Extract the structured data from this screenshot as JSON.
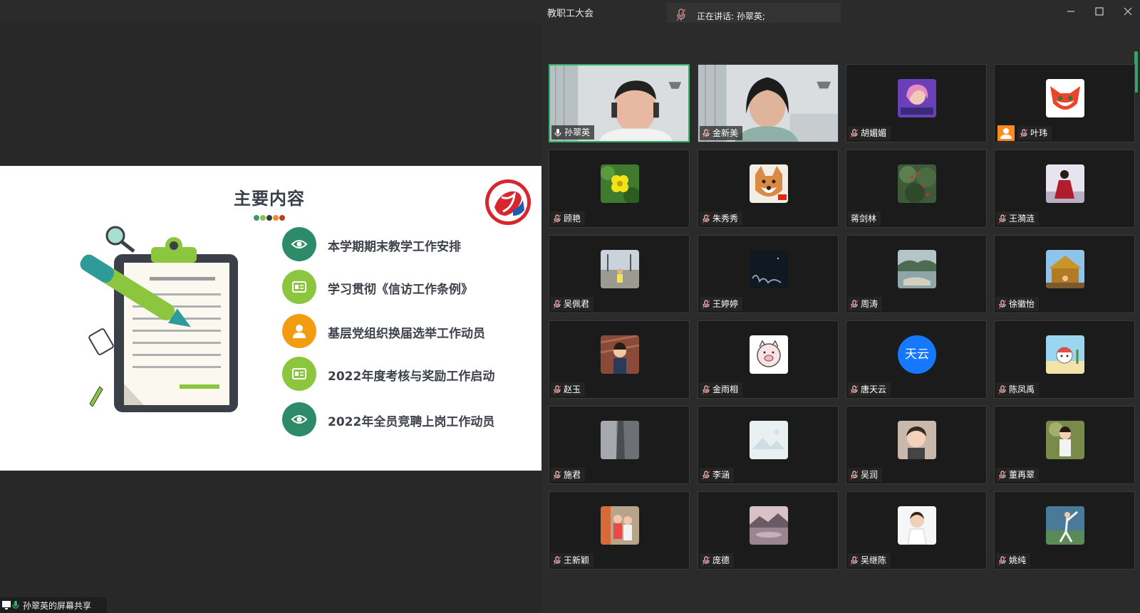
{
  "window": {
    "title": "教职工大会",
    "speaking_label": "正在讲话: 孙翠英;"
  },
  "slide": {
    "title": "主要内容",
    "dot_colors": [
      "#3a9a6b",
      "#8bc34a",
      "#333a44",
      "#f08a24",
      "#c0392b"
    ],
    "items": [
      {
        "label": "本学期期末教学工作安排",
        "color": "#2e8b6a",
        "icon": "eye-icon"
      },
      {
        "label": "学习贯彻《信访工作条例》",
        "color": "#8cc63f",
        "icon": "id-card-icon"
      },
      {
        "label": "基层党组织换届选举工作动员",
        "color": "#f39c12",
        "icon": "person-icon"
      },
      {
        "label": "2022年度考核与奖励工作启动",
        "color": "#8cc63f",
        "icon": "id-card-icon"
      },
      {
        "label": "2022年全员竞聘上岗工作动员",
        "color": "#2e8b6a",
        "icon": "eye-icon"
      }
    ]
  },
  "share_status": {
    "label": "孙翠英的屏幕共享"
  },
  "participants": [
    {
      "name": "孙翠英",
      "type": "video",
      "active": true
    },
    {
      "name": "金新美",
      "type": "video"
    },
    {
      "name": "胡媚媚",
      "type": "avatar",
      "avatar": "anime-avatar"
    },
    {
      "name": "叶玮",
      "type": "avatar",
      "avatar": "fox-avatar",
      "host": true
    },
    {
      "name": "顾艳",
      "type": "avatar",
      "avatar": "flower-avatar"
    },
    {
      "name": "朱秀秀",
      "type": "avatar",
      "avatar": "dog-avatar"
    },
    {
      "name": "蒋剑林",
      "type": "avatar",
      "avatar": "tree-avatar",
      "no_mic": true
    },
    {
      "name": "王漪涟",
      "type": "avatar",
      "avatar": "portrait-avatar"
    },
    {
      "name": "吴佩君",
      "type": "avatar",
      "avatar": "street-avatar"
    },
    {
      "name": "王婷婷",
      "type": "avatar",
      "avatar": "night-avatar"
    },
    {
      "name": "周涛",
      "type": "avatar",
      "avatar": "lake-avatar"
    },
    {
      "name": "徐徽怡",
      "type": "avatar",
      "avatar": "temple-avatar"
    },
    {
      "name": "赵玉",
      "type": "avatar",
      "avatar": "child-avatar"
    },
    {
      "name": "金雨相",
      "type": "avatar",
      "avatar": "pig-avatar"
    },
    {
      "name": "唐天云",
      "type": "text",
      "avatar_text": "天云"
    },
    {
      "name": "陈凤禹",
      "type": "avatar",
      "avatar": "cartoon-avatar"
    },
    {
      "name": "施君",
      "type": "avatar",
      "avatar": "photo-avatar"
    },
    {
      "name": "李涵",
      "type": "avatar",
      "avatar": "placeholder-avatar"
    },
    {
      "name": "吴润",
      "type": "avatar",
      "avatar": "baby-avatar"
    },
    {
      "name": "董再翠",
      "type": "avatar",
      "avatar": "girl-avatar"
    },
    {
      "name": "王新颖",
      "type": "avatar",
      "avatar": "family-avatar"
    },
    {
      "name": "庞德",
      "type": "avatar",
      "avatar": "mountain-avatar"
    },
    {
      "name": "吴继陈",
      "type": "avatar",
      "avatar": "toddler-avatar"
    },
    {
      "name": "姚纯",
      "type": "avatar",
      "avatar": "dance-avatar"
    }
  ],
  "colors": {
    "active_border": "#2fb36a",
    "host_badge": "#ff8a1f",
    "avatar_blue": "#1677ff"
  }
}
